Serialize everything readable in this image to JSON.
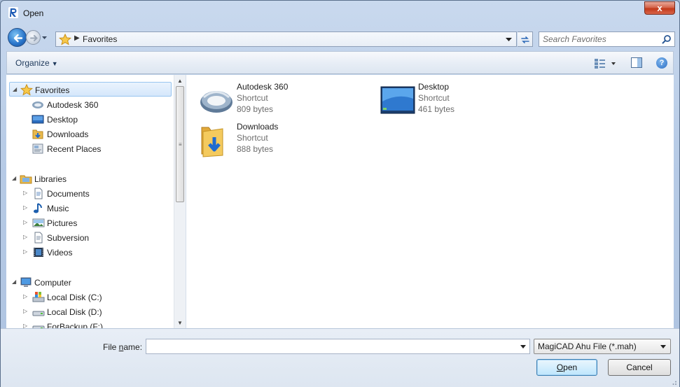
{
  "window": {
    "title": "Open",
    "close_glyph": "x"
  },
  "nav": {
    "address_segment": "Favorites",
    "search_placeholder": "Search Favorites"
  },
  "toolbar": {
    "organize_label": "Organize",
    "help_glyph": "?"
  },
  "sidebar": {
    "groups": [
      {
        "label": "Favorites",
        "icon": "star-icon",
        "items": [
          {
            "label": "Autodesk 360",
            "icon": "autodesk360-icon"
          },
          {
            "label": "Desktop",
            "icon": "desktop-icon"
          },
          {
            "label": "Downloads",
            "icon": "downloads-icon"
          },
          {
            "label": "Recent Places",
            "icon": "recent-places-icon"
          }
        ]
      },
      {
        "label": "Libraries",
        "icon": "libraries-icon",
        "items": [
          {
            "label": "Documents",
            "icon": "documents-icon"
          },
          {
            "label": "Music",
            "icon": "music-icon"
          },
          {
            "label": "Pictures",
            "icon": "pictures-icon"
          },
          {
            "label": "Subversion",
            "icon": "subversion-icon"
          },
          {
            "label": "Videos",
            "icon": "videos-icon"
          }
        ]
      },
      {
        "label": "Computer",
        "icon": "computer-icon",
        "items": [
          {
            "label": "Local Disk (C:)",
            "icon": "system-drive-icon"
          },
          {
            "label": "Local Disk (D:)",
            "icon": "drive-icon"
          },
          {
            "label": "ForBackup (F:)",
            "icon": "drive-icon"
          }
        ]
      }
    ]
  },
  "files": [
    {
      "name": "Autodesk 360",
      "type": "Shortcut",
      "size": "809 bytes",
      "icon": "autodesk360-icon"
    },
    {
      "name": "Desktop",
      "type": "Shortcut",
      "size": "461 bytes",
      "icon": "desktop-icon"
    },
    {
      "name": "Downloads",
      "type": "Shortcut",
      "size": "888 bytes",
      "icon": "downloads-folder-icon"
    }
  ],
  "bottom": {
    "file_name_label_pre": "File ",
    "file_name_label_accel": "n",
    "file_name_label_post": "ame:",
    "file_name_value": "",
    "filter_value": "MagiCAD Ahu File (*.mah)",
    "open_accel": "O",
    "open_rest": "pen",
    "cancel_label": "Cancel"
  },
  "colors": {
    "accent": "#2773c9",
    "close": "#c2391a",
    "selection": "#d5e7fb"
  }
}
